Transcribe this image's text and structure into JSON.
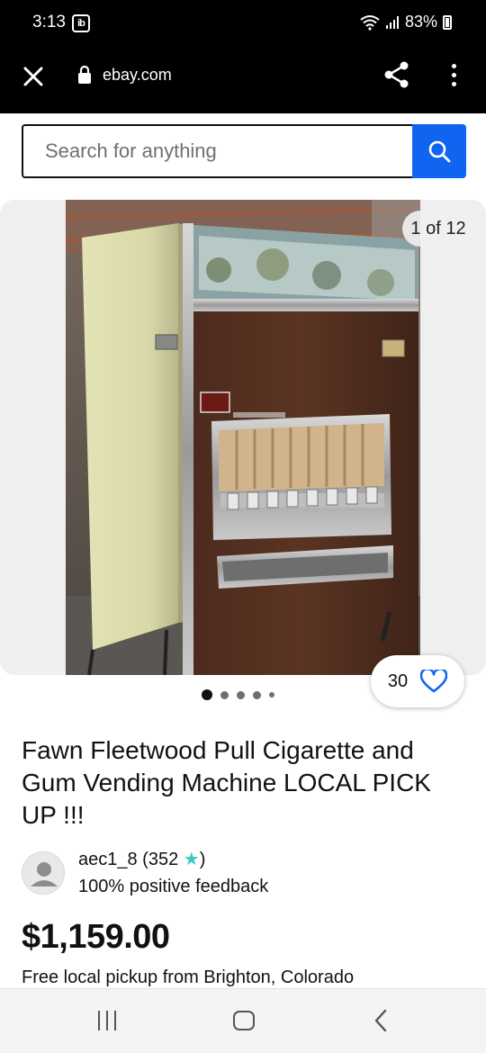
{
  "status": {
    "time": "3:13",
    "app_icon": "ib",
    "battery": "83%",
    "icons": [
      "wifi-icon",
      "signal-icon",
      "battery-icon"
    ]
  },
  "browser": {
    "url": "ebay.com",
    "icons": [
      "close-icon",
      "lock-icon",
      "share-icon",
      "more-vert-icon"
    ]
  },
  "search": {
    "placeholder": "Search for anything",
    "value": ""
  },
  "gallery": {
    "counter": "1 of 12",
    "total_dots": 5,
    "active_dot": 0
  },
  "watch": {
    "count": "30",
    "icon": "heart-icon"
  },
  "listing": {
    "title": "Fawn Fleetwood  Pull Cigarette and Gum Vending Machine LOCAL PICK UP !!!",
    "seller_name": "aec1_8 (352",
    "seller_name_suffix": ")",
    "seller_feedback": "100% positive feedback",
    "price": "$1,159.00",
    "shipping": "Free local pickup from Brighton, Colorado"
  },
  "colors": {
    "accent": "#0f65ef",
    "star": "#3ac9c0",
    "text": "#111111"
  }
}
